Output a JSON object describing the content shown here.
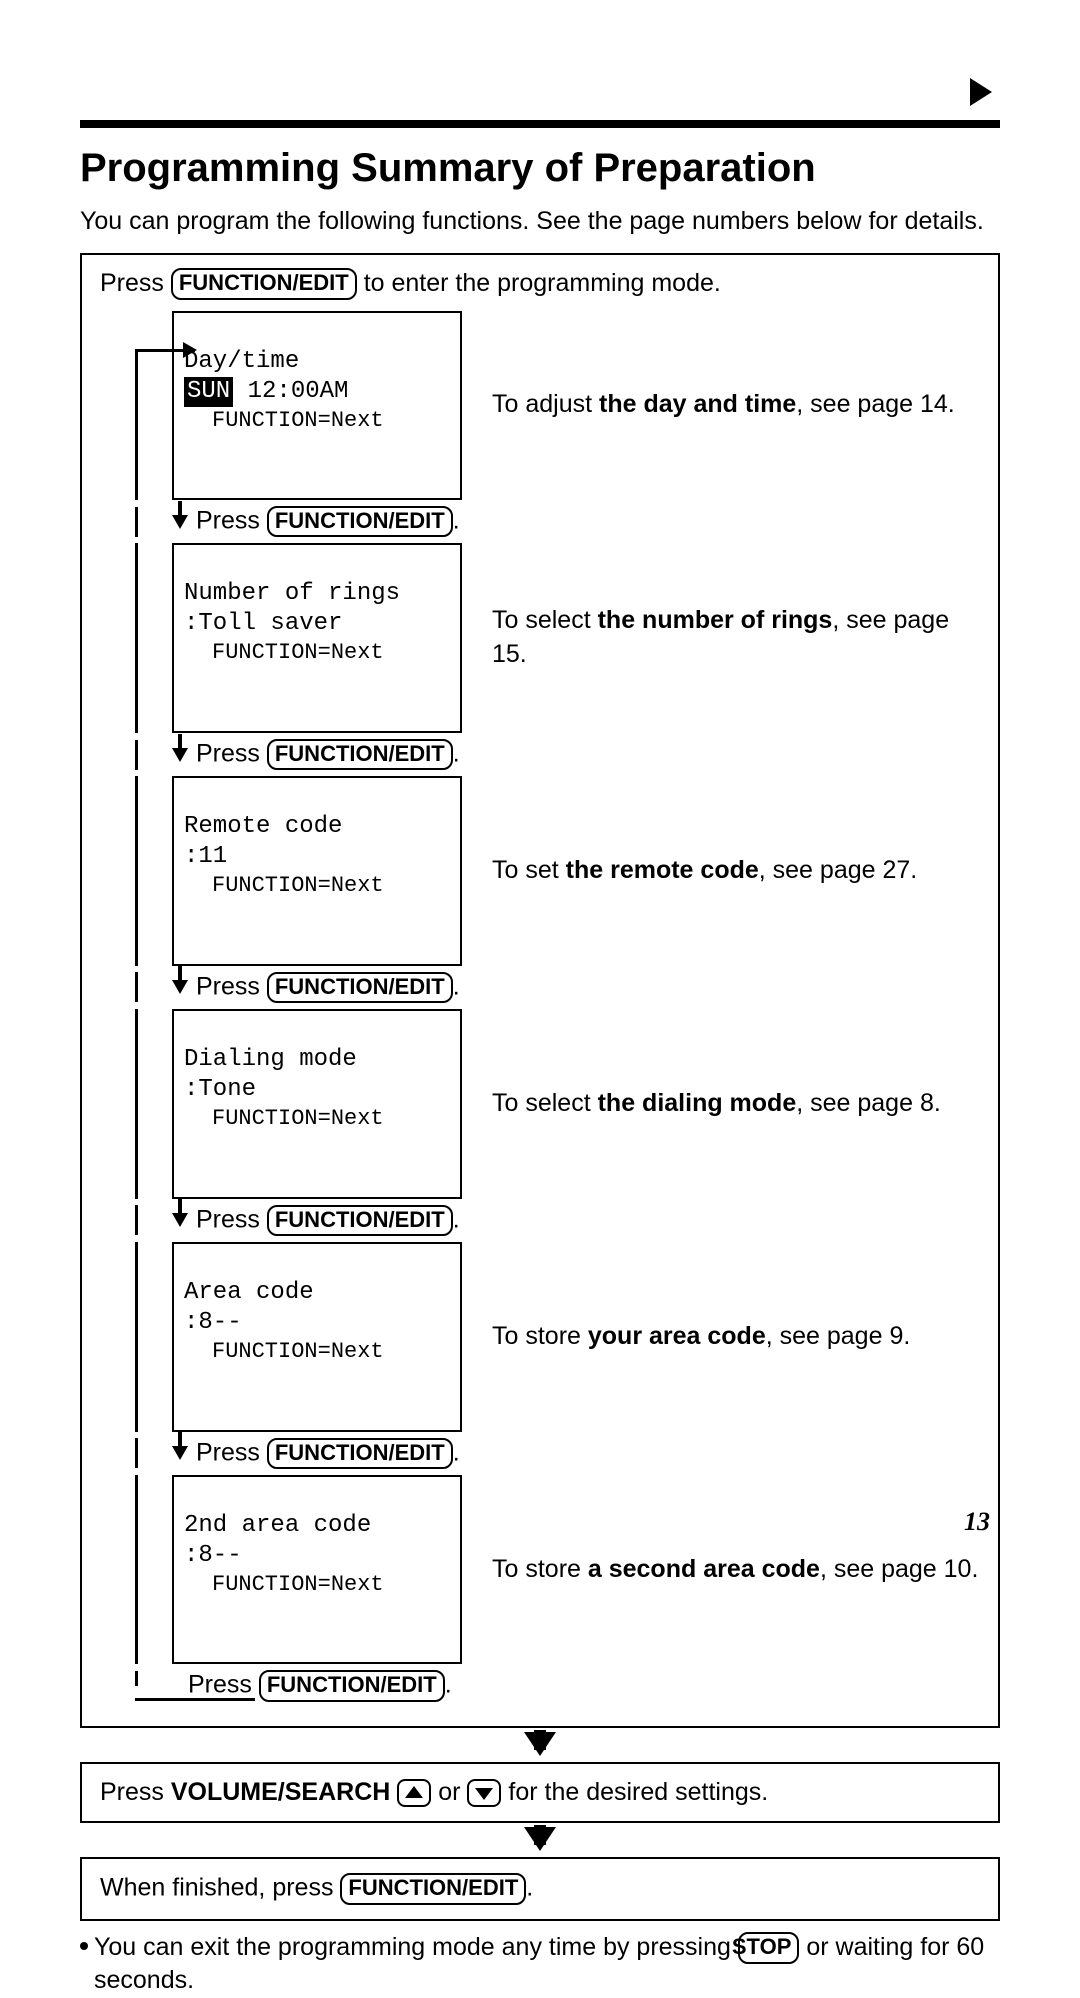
{
  "page_number": "13",
  "title": "Programming Summary of Preparation",
  "intro": "You can program the following functions. See the page numbers below for details.",
  "btn_function_edit": "FUNCTION/EDIT",
  "btn_stop": "STOP",
  "top_line_pre": "Press ",
  "top_line_post": " to enter the programming mode.",
  "press_label": "Press ",
  "steps": [
    {
      "lcd_l1": "Day/time",
      "lcd_l2_inv": "SUN",
      "lcd_l2_rest": " 12:00AM",
      "lcd_l3": "FUNCTION=Next",
      "desc_pre": "To adjust ",
      "desc_bold": "the day and time",
      "desc_post": ", see page 14."
    },
    {
      "lcd_l1": "Number of rings",
      "lcd_l2": ":Toll saver",
      "lcd_l3": "FUNCTION=Next",
      "desc_pre": "To select ",
      "desc_bold": "the number of rings",
      "desc_post": ", see page 15."
    },
    {
      "lcd_l1": "Remote code",
      "lcd_l2": ":11",
      "lcd_l3": "FUNCTION=Next",
      "desc_pre": "To set ",
      "desc_bold": "the remote code",
      "desc_post": ", see page 27."
    },
    {
      "lcd_l1": "Dialing mode",
      "lcd_l2": ":Tone",
      "lcd_l3": "FUNCTION=Next",
      "desc_pre": "To select ",
      "desc_bold": "the dialing mode",
      "desc_post": ", see page 8."
    },
    {
      "lcd_l1": "Area code",
      "lcd_l2": ":8--",
      "lcd_l3": "FUNCTION=Next",
      "desc_pre": "To store ",
      "desc_bold": "your area code",
      "desc_post": ", see page 9."
    },
    {
      "lcd_l1": "2nd area code",
      "lcd_l2": ":8--",
      "lcd_l3": "FUNCTION=Next",
      "desc_pre": "To store ",
      "desc_bold": "a second area code",
      "desc_post": ", see page 10."
    }
  ],
  "volume_line_pre": "Press ",
  "volume_bold": "VOLUME/SEARCH",
  "volume_mid": " or ",
  "volume_post": " for the desired settings.",
  "finish_pre": "When finished, press ",
  "footnote_pre": "You can exit the programming mode any time by pressing ",
  "footnote_post": " or waiting for 60 seconds."
}
